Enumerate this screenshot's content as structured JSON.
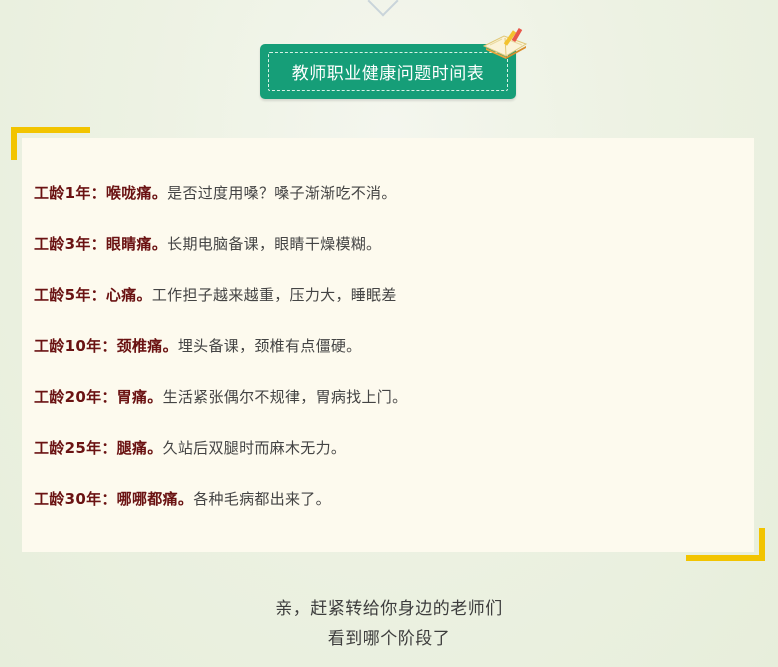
{
  "title": "教师职业健康问题时间表",
  "items": [
    {
      "label": "工龄1年：喉咙痛。",
      "text": "是否过度用嗓？嗓子渐渐吃不消。"
    },
    {
      "label": "工龄3年：眼睛痛。",
      "text": "长期电脑备课，眼睛干燥模糊。"
    },
    {
      "label": "工龄5年：心痛。",
      "text": "工作担子越来越重，压力大，睡眠差"
    },
    {
      "label": "工龄10年：颈椎痛。",
      "text": "埋头备课，颈椎有点僵硬。"
    },
    {
      "label": "工龄20年：胃痛。",
      "text": "生活紧张偶尔不规律，胃病找上门。"
    },
    {
      "label": "工龄25年：腿痛。",
      "text": "久站后双腿时而麻木无力。"
    },
    {
      "label": "工龄30年：哪哪都痛。",
      "text": "各种毛病都出来了。"
    }
  ],
  "footer": {
    "line1": "亲，赶紧转给你身边的老师们",
    "line2": "看到哪个阶段了"
  },
  "colors": {
    "title_bg": "#169e78",
    "accent_yellow": "#f2c400",
    "label": "#6a1212",
    "card_bg": "#fdfaee"
  },
  "icons": [
    "chevron-down-icon",
    "book-pencil-icon"
  ]
}
